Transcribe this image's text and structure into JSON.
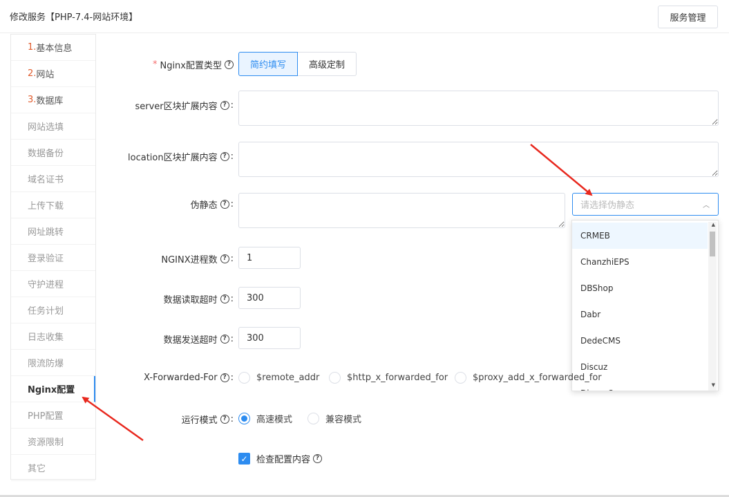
{
  "header": {
    "title": "修改服务【PHP-7.4-网站环境】",
    "service_button": "服务管理"
  },
  "sidebar": {
    "items": [
      {
        "num": "1.",
        "label": "基本信息"
      },
      {
        "num": "2.",
        "label": "网站"
      },
      {
        "num": "3.",
        "label": "数据库"
      },
      {
        "num": "",
        "label": "网站选填"
      },
      {
        "num": "",
        "label": "数据备份"
      },
      {
        "num": "",
        "label": "域名证书"
      },
      {
        "num": "",
        "label": "上传下载"
      },
      {
        "num": "",
        "label": "网址跳转"
      },
      {
        "num": "",
        "label": "登录验证"
      },
      {
        "num": "",
        "label": "守护进程"
      },
      {
        "num": "",
        "label": "任务计划"
      },
      {
        "num": "",
        "label": "日志收集"
      },
      {
        "num": "",
        "label": "限流防爆"
      },
      {
        "num": "",
        "label": "Nginx配置"
      },
      {
        "num": "",
        "label": "PHP配置"
      },
      {
        "num": "",
        "label": "资源限制"
      },
      {
        "num": "",
        "label": "其它"
      }
    ],
    "active": "Nginx配置"
  },
  "form": {
    "nginx_type": {
      "required_mark": "*",
      "label": "Nginx配置类型",
      "options": [
        "简约填写",
        "高级定制"
      ],
      "selected": "简约填写"
    },
    "server_block": {
      "label": "server区块扩展内容",
      "value": ""
    },
    "location_block": {
      "label": "location区块扩展内容",
      "value": ""
    },
    "rewrite": {
      "label": "伪静态",
      "value": "",
      "select_placeholder": "请选择伪静态",
      "dropdown_options": [
        "CRMEB",
        "ChanzhiEPS",
        "DBShop",
        "Dabr",
        "DedeCMS",
        "Discuz",
        "DiscuzQ"
      ],
      "highlighted": "CRMEB"
    },
    "worker_processes": {
      "label": "NGINX进程数",
      "value": "1"
    },
    "read_timeout": {
      "label": "数据读取超时",
      "value": "300"
    },
    "send_timeout": {
      "label": "数据发送超时",
      "value": "300"
    },
    "x_forwarded_for": {
      "label": "X-Forwarded-For",
      "options": [
        "$remote_addr",
        "$http_x_forwarded_for",
        "$proxy_add_x_forwarded_for"
      ],
      "selected": ""
    },
    "run_mode": {
      "label": "运行模式",
      "options": [
        "高速模式",
        "兼容模式"
      ],
      "selected": "高速模式"
    },
    "check_config": {
      "label": "检查配置内容",
      "checked": true
    }
  },
  "colors": {
    "accent": "#2d8cf0",
    "required": "#f56c6c",
    "annotation_arrow": "#e8281e"
  }
}
